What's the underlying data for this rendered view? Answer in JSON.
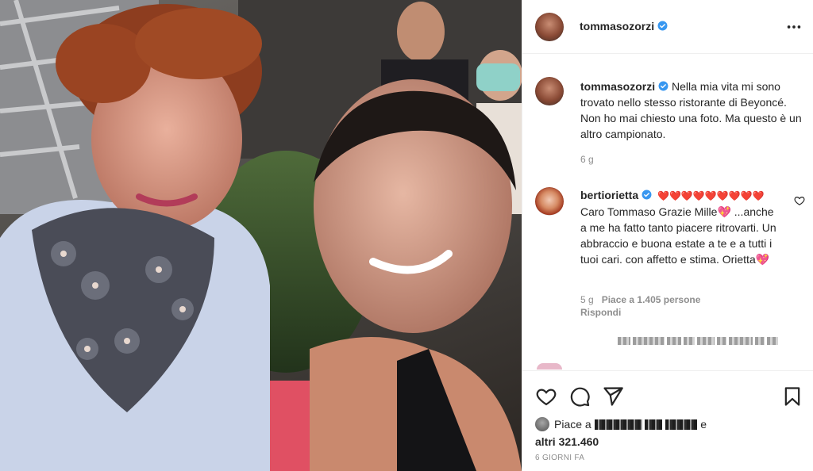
{
  "post": {
    "username": "tommasozorzi",
    "verified": true,
    "caption": "Nella mia vita mi sono trovato nello stesso ristorante di Beyoncé. Non ho mai chiesto una foto. Ma questo è un altro campionato.",
    "caption_time": "6 g"
  },
  "comment": {
    "username": "bertiorietta",
    "verified": true,
    "text_line1": "❤️❤️❤️❤️❤️❤️❤️❤️❤️",
    "text": "Caro Tommaso Grazie Mille💖 ...anche a me ha fatto tanto piacere ritrovarti. Un abbraccio e buona estate a te e a tutti i tuoi cari. con affetto e stima. Orietta💖",
    "time": "5 g",
    "likes": "Piace a 1.405 persone",
    "reply_label": "Rispondi"
  },
  "footer": {
    "likes_prefix": "Piace a",
    "likes_joiner": "e",
    "likes_others": "altri 321.460",
    "date": "6 GIORNI FA"
  },
  "icons": {
    "more": "more-horizontal-icon",
    "like": "heart-icon",
    "comment": "comment-icon",
    "share": "paper-plane-icon",
    "save": "bookmark-icon"
  },
  "colors": {
    "verified": "#3897f0",
    "text": "#262626",
    "muted": "#8e8e8e",
    "divider": "#efefef"
  }
}
